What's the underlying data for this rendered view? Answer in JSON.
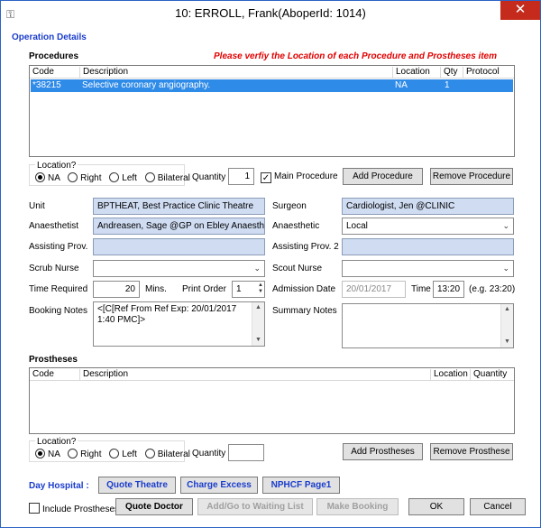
{
  "window": {
    "title": "10: ERROLL, Frank(AboperId: 1014)",
    "close_glyph": "✕"
  },
  "operation_details": "Operation Details",
  "procedures": {
    "heading": "Procedures",
    "warning": "Please verfiy the Location of each Procedure and Prostheses item",
    "columns": [
      "Code",
      "Description",
      "Location",
      "Qty",
      "Protocol"
    ],
    "rows": [
      {
        "code": "*38215",
        "description": "Selective coronary angiography.",
        "location": "NA",
        "qty": "1",
        "protocol": ""
      }
    ],
    "location_label": "Location?",
    "location_options": [
      "NA",
      "Right",
      "Left",
      "Bilateral"
    ],
    "location_selected": "NA",
    "quantity_label": "Quantity",
    "quantity_value": "1",
    "main_procedure_label": "Main Procedure",
    "main_procedure_checked": true,
    "add_button": "Add Procedure",
    "remove_button": "Remove Procedure"
  },
  "form": {
    "unit_label": "Unit",
    "unit_value": "BPTHEAT, Best Practice Clinic Theatre",
    "surgeon_label": "Surgeon",
    "surgeon_value": "Cardiologist, Jen @CLINIC",
    "anaesthetist_label": "Anaesthetist",
    "anaesthetist_value": "Andreasen, Sage @GP on Ebley Anaesthetist",
    "anaesthetic_label": "Anaesthetic",
    "anaesthetic_value": "Local",
    "assisting_label": "Assisting Prov.",
    "assisting_value": "",
    "assisting2_label": "Assisting Prov. 2",
    "assisting2_value": "",
    "scrub_label": "Scrub Nurse",
    "scrub_value": "",
    "scout_label": "Scout Nurse",
    "scout_value": "",
    "time_required_label": "Time Required",
    "time_required_value": "20",
    "mins_label": "Mins.",
    "print_order_label": "Print Order",
    "print_order_value": "1",
    "admission_date_label": "Admission Date",
    "admission_date_value": "20/01/2017",
    "time_label": "Time",
    "time_value": "13:20",
    "time_hint": "(e.g. 23:20)",
    "booking_notes_label": "Booking Notes",
    "booking_notes_value": "<[C[Ref From  Ref Exp: 20/01/2017 1:40 PMC]>",
    "summary_notes_label": "Summary Notes",
    "summary_notes_value": ""
  },
  "prostheses": {
    "heading": "Prostheses",
    "columns": [
      "Code",
      "Description",
      "Location",
      "Quantity"
    ],
    "location_label": "Location?",
    "location_options": [
      "NA",
      "Right",
      "Left",
      "Bilateral"
    ],
    "location_selected": "NA",
    "quantity_label": "Quantity",
    "quantity_value": "",
    "add_button": "Add Prostheses",
    "remove_button": "Remove Prosthese"
  },
  "footer": {
    "day_hospital_label": "Day Hospital :",
    "quote_theatre": "Quote Theatre",
    "charge_excess": "Charge Excess",
    "nphcf": "NPHCF Page1",
    "include_prostheses": "Include Prostheses",
    "quote_doctor": "Quote Doctor",
    "add_waiting": "Add/Go to Waiting List",
    "make_booking": "Make Booking",
    "ok": "OK",
    "cancel": "Cancel"
  }
}
